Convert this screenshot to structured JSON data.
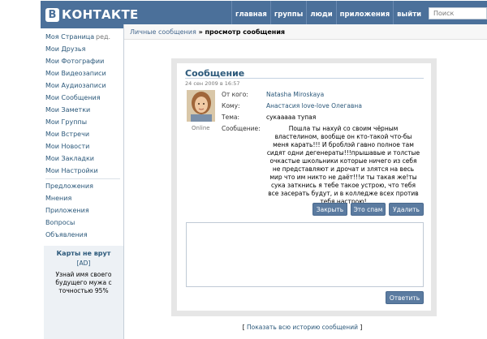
{
  "header": {
    "logo_letter": "В",
    "logo_text": "КОНТАКТЕ",
    "nav": [
      "главная",
      "группы",
      "люди",
      "приложения",
      "выйти"
    ],
    "search_placeholder": "Поиск"
  },
  "sidebar": {
    "edit_label": "ред.",
    "items": [
      "Моя Страница",
      "Мои Друзья",
      "Мои Фотографии",
      "Мои Видеозаписи",
      "Мои Аудиозаписи",
      "Мои Сообщения",
      "Мои Заметки",
      "Мои Группы",
      "Мои Встречи",
      "Мои Новости",
      "Мои Закладки",
      "Мои Настройки"
    ],
    "extra_items": [
      "Предложения",
      "Мнения",
      "Приложения",
      "Вопросы",
      "Объявления"
    ]
  },
  "ad": {
    "title": "Карты не врут",
    "tag": "[AD]",
    "text": "Узнай имя своего будущего мужа с точностью 95%"
  },
  "breadcrumb": {
    "section": "Личные сообщения",
    "separator": " » ",
    "current": "просмотр сообщения"
  },
  "message": {
    "title": "Сообщение",
    "date": "24 сен 2009 в 16:57",
    "online": "Online",
    "from_label": "От кого:",
    "from": "Natasha Miroskaya",
    "to_label": "Кому:",
    "to": "Анастасия love-love Олегавна",
    "subject_label": "Тема:",
    "subject": "сукааааа тупая",
    "body_label": "Сообщение:",
    "body": "Пошла ты нахуй со своим чёрным властелином, вообще он кто-такой что-бы меня карать!!! И броблэй гавно полное там сидят одни дегенераты!!!прышавые и толстые очкастые школьники которые ничего из себя не представляют и дрочат и злятся на весь мир что им никто не даёт!!!и ты такая же!ты сука заткнись я тебе такое устрою, что тебя все засерать будут, и в колледже всех против тебя настрою!"
  },
  "buttons": {
    "close": "Закрыть",
    "spam": "Это спам",
    "delete": "Удалить",
    "reply": "Ответить"
  },
  "history": {
    "open": "[ ",
    "link": "Показать всю историю сообщений",
    "close": " ]"
  },
  "colors": {
    "header_blue": "#4b709a",
    "link_blue": "#2b587a",
    "button_blue": "#5b7ba0",
    "frame_gray": "#e6e6e6"
  }
}
